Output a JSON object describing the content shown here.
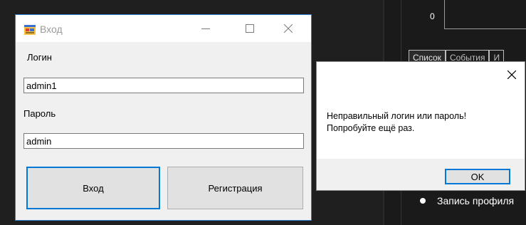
{
  "background_app": {
    "graph_zero_label": "0",
    "tabs": [
      "Список",
      "События",
      "И"
    ],
    "radio_label": "Запись профиля"
  },
  "login_window": {
    "title": "Вход",
    "login_label": "Логин",
    "login_value": "admin1",
    "password_label": "Пароль",
    "password_value": "admin",
    "enter_button": "Вход",
    "register_button": "Регистрация"
  },
  "message_box": {
    "line1": "Неправильный логин или пароль!",
    "line2": "Попробуйте ещё раз.",
    "ok_button": "OK"
  },
  "colors": {
    "accent": "#0078d7",
    "window_bg": "#f0f0f0",
    "dark_bg": "#1e1e1e"
  }
}
